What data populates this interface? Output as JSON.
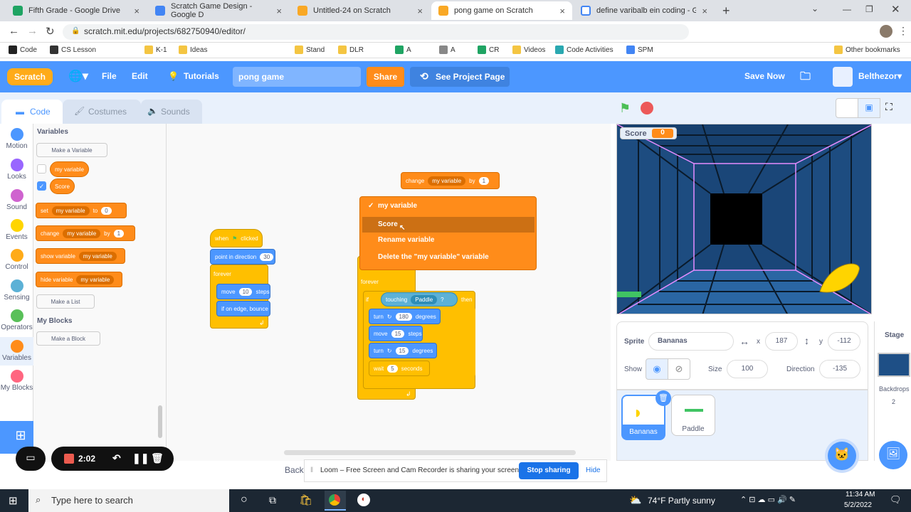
{
  "browser": {
    "tabs": [
      {
        "title": "Fifth Grade - Google Drive",
        "color": "#1fa463"
      },
      {
        "title": "Scratch Game Design - Google D",
        "color": "#4285f4"
      },
      {
        "title": "Untitled-24 on Scratch",
        "color": "#f9a825"
      },
      {
        "title": "pong game on Scratch",
        "color": "#f9a825"
      },
      {
        "title": "define varibalb ein coding - Goo",
        "color": "#4285f4"
      }
    ],
    "url": "scratch.mit.edu/projects/682750940/editor/",
    "bookmarks": [
      "Code",
      "CS Lesson",
      "K-1",
      "Ideas",
      "Stand",
      "DLR",
      "A",
      "A",
      "CR",
      "Videos",
      "Code Activities",
      "SPM",
      "Other bookmarks"
    ]
  },
  "menubar": {
    "logo": "Scratch",
    "file": "File",
    "edit": "Edit",
    "tutorials": "Tutorials",
    "project_title": "pong game",
    "share": "Share",
    "see_project": "See Project Page",
    "save_now": "Save Now",
    "user": "Belthezor"
  },
  "editor_tabs": {
    "code": "Code",
    "costumes": "Costumes",
    "sounds": "Sounds"
  },
  "categories": [
    {
      "label": "Motion",
      "color": "#4c97ff"
    },
    {
      "label": "Looks",
      "color": "#9966ff"
    },
    {
      "label": "Sound",
      "color": "#cf63cf"
    },
    {
      "label": "Events",
      "color": "#ffd500"
    },
    {
      "label": "Control",
      "color": "#ffab19"
    },
    {
      "label": "Sensing",
      "color": "#5cb1d6"
    },
    {
      "label": "Operators",
      "color": "#59c059"
    },
    {
      "label": "Variables",
      "color": "#ff8c1a"
    },
    {
      "label": "My Blocks",
      "color": "#ff6680"
    }
  ],
  "palette": {
    "variables_header": "Variables",
    "make_variable": "Make a Variable",
    "var1": "my variable",
    "var2": "Score",
    "set_block": {
      "set": "set",
      "var": "my variable",
      "to": "to",
      "value": "0"
    },
    "change_block": {
      "change": "change",
      "var": "my variable",
      "by": "by",
      "value": "1"
    },
    "show_block": {
      "show": "show variable",
      "var": "my variable"
    },
    "hide_block": {
      "hide": "hide variable",
      "var": "my variable"
    },
    "make_list": "Make a List",
    "myblocks_header": "My Blocks",
    "make_block": "Make a Block"
  },
  "script": {
    "change_block": {
      "change": "change",
      "var": "my variable",
      "by": "by",
      "value": "1"
    },
    "when_clicked": {
      "when": "when",
      "clicked": "clicked"
    },
    "point_dir": {
      "text": "point in direction",
      "value": "30"
    },
    "forever1": "forever",
    "move1": {
      "text": "move",
      "value": "10",
      "steps": "steps"
    },
    "bounce": "if on edge, bounce",
    "forever2": "forever",
    "if_block": {
      "if": "if",
      "touching": "touching",
      "target": "Paddle",
      "q": "?",
      "then": "then"
    },
    "turn1": {
      "turn": "turn",
      "value": "180",
      "degrees": "degrees"
    },
    "move2": {
      "text": "move",
      "value": "15",
      "steps": "steps"
    },
    "turn2": {
      "turn": "turn",
      "value": "15",
      "degrees": "degrees"
    },
    "wait": {
      "text": "wait",
      "value": "5",
      "seconds": "seconds"
    }
  },
  "dropdown": {
    "items": [
      "my variable",
      "Score",
      "Rename variable",
      "Delete the \"my variable\" variable"
    ],
    "checked": "✓"
  },
  "stage": {
    "monitor_label": "Score",
    "monitor_value": "0"
  },
  "sprite_info": {
    "sprite_label": "Sprite",
    "sprite_name": "Bananas",
    "x_label": "x",
    "x": "187",
    "y_label": "y",
    "y": "-112",
    "show_label": "Show",
    "size_label": "Size",
    "size": "100",
    "direction_label": "Direction",
    "direction": "-135"
  },
  "sprites": [
    {
      "name": "Bananas",
      "selected": true
    },
    {
      "name": "Paddle",
      "selected": false
    }
  ],
  "stage_pane": {
    "label": "Stage",
    "backdrops_label": "Backdrops",
    "backdrops_count": "2"
  },
  "backpack": "Back",
  "loom": {
    "message": "Loom – Free Screen and Cam Recorder is sharing your screen.",
    "stop": "Stop sharing",
    "hide": "Hide"
  },
  "recorder": {
    "time": "2:02"
  },
  "taskbar": {
    "search": "Type here to search",
    "weather": "74°F  Partly sunny",
    "time": "11:34 AM",
    "date": "5/2/2022"
  }
}
